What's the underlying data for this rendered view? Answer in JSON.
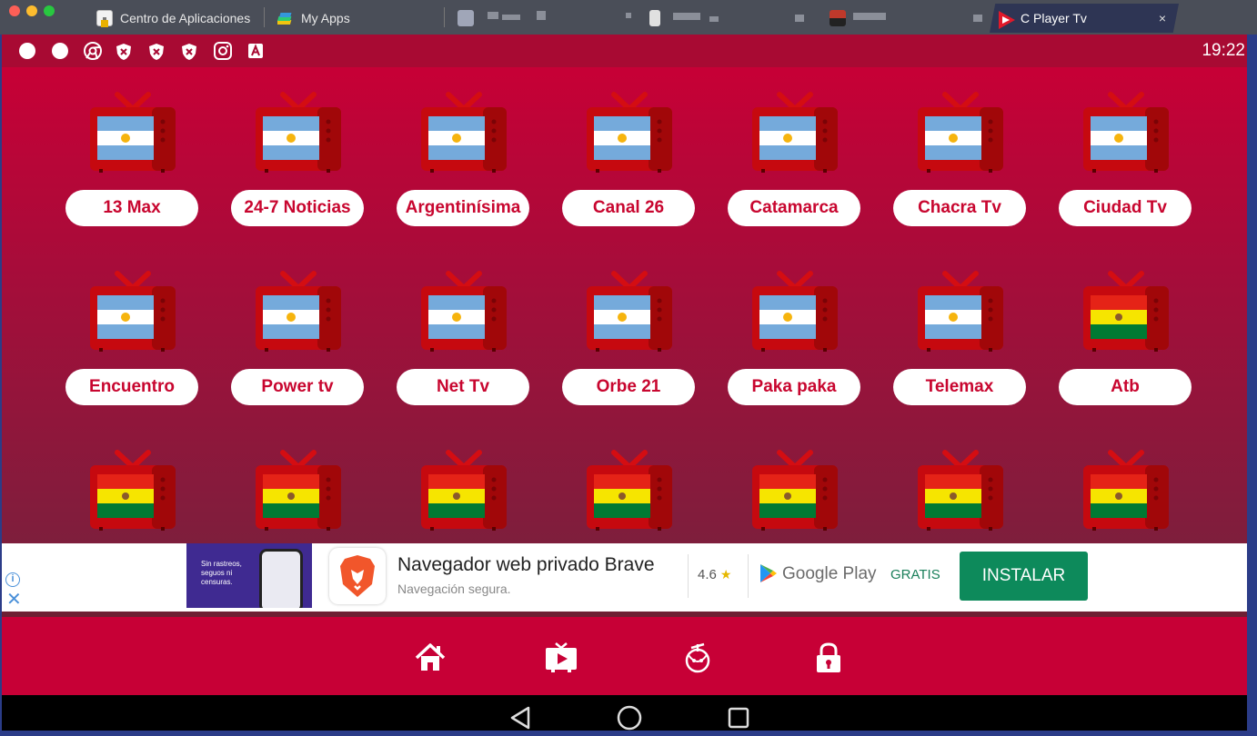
{
  "browser": {
    "tabs": [
      {
        "label": "Centro de Aplicaciones",
        "icon": "app-center-icon"
      },
      {
        "label": "My Apps",
        "icon": "bluestacks-icon"
      },
      {
        "label": "",
        "icon": "blurred-tab-icon"
      },
      {
        "label": "",
        "icon": "blurred-tab-icon"
      },
      {
        "label": "",
        "icon": "blurred-tab-icon"
      },
      {
        "label": "C Player Tv",
        "icon": "c-player-icon",
        "active": true
      }
    ],
    "close_glyph": "×"
  },
  "statusbar": {
    "time": "19:22",
    "icons": [
      "dot-icon",
      "dot-icon",
      "chrome-icon",
      "shield-x-icon",
      "shield-x-icon",
      "shield-x-icon",
      "instagram-icon",
      "font-icon"
    ]
  },
  "channels": [
    {
      "name": "13 Max",
      "flag": "argentina"
    },
    {
      "name": "24-7 Noticias",
      "flag": "argentina"
    },
    {
      "name": "Argentinísima",
      "flag": "argentina"
    },
    {
      "name": "Canal 26",
      "flag": "argentina"
    },
    {
      "name": "Catamarca",
      "flag": "argentina"
    },
    {
      "name": "Chacra Tv",
      "flag": "argentina"
    },
    {
      "name": "Ciudad Tv",
      "flag": "argentina"
    },
    {
      "name": "Encuentro",
      "flag": "argentina"
    },
    {
      "name": "Power tv",
      "flag": "argentina"
    },
    {
      "name": "Net Tv",
      "flag": "argentina"
    },
    {
      "name": "Orbe 21",
      "flag": "argentina"
    },
    {
      "name": "Paka paka",
      "flag": "argentina"
    },
    {
      "name": "Telemax",
      "flag": "argentina"
    },
    {
      "name": "Atb",
      "flag": "bolivia"
    },
    {
      "name": "",
      "flag": "bolivia"
    },
    {
      "name": "",
      "flag": "bolivia"
    },
    {
      "name": "",
      "flag": "bolivia"
    },
    {
      "name": "",
      "flag": "bolivia"
    },
    {
      "name": "",
      "flag": "bolivia"
    },
    {
      "name": "",
      "flag": "bolivia"
    },
    {
      "name": "",
      "flag": "bolivia"
    }
  ],
  "ad": {
    "image_text": "Sin rastreos, seguos ni censuras.",
    "title": "Navegador web privado Brave",
    "subtitle": "Navegación segura.",
    "rating": "4.6",
    "star": "★",
    "store": "Google Play",
    "price": "GRATIS",
    "cta": "INSTALAR",
    "info_glyph": "i",
    "close_glyph": "✕"
  },
  "nav": {
    "items": [
      "home-icon",
      "tv-play-icon",
      "sports-ball-icon",
      "lock-icon"
    ]
  },
  "colors": {
    "primary": "#c70036",
    "label_text": "#c8062f",
    "install": "#0d8a5b"
  }
}
